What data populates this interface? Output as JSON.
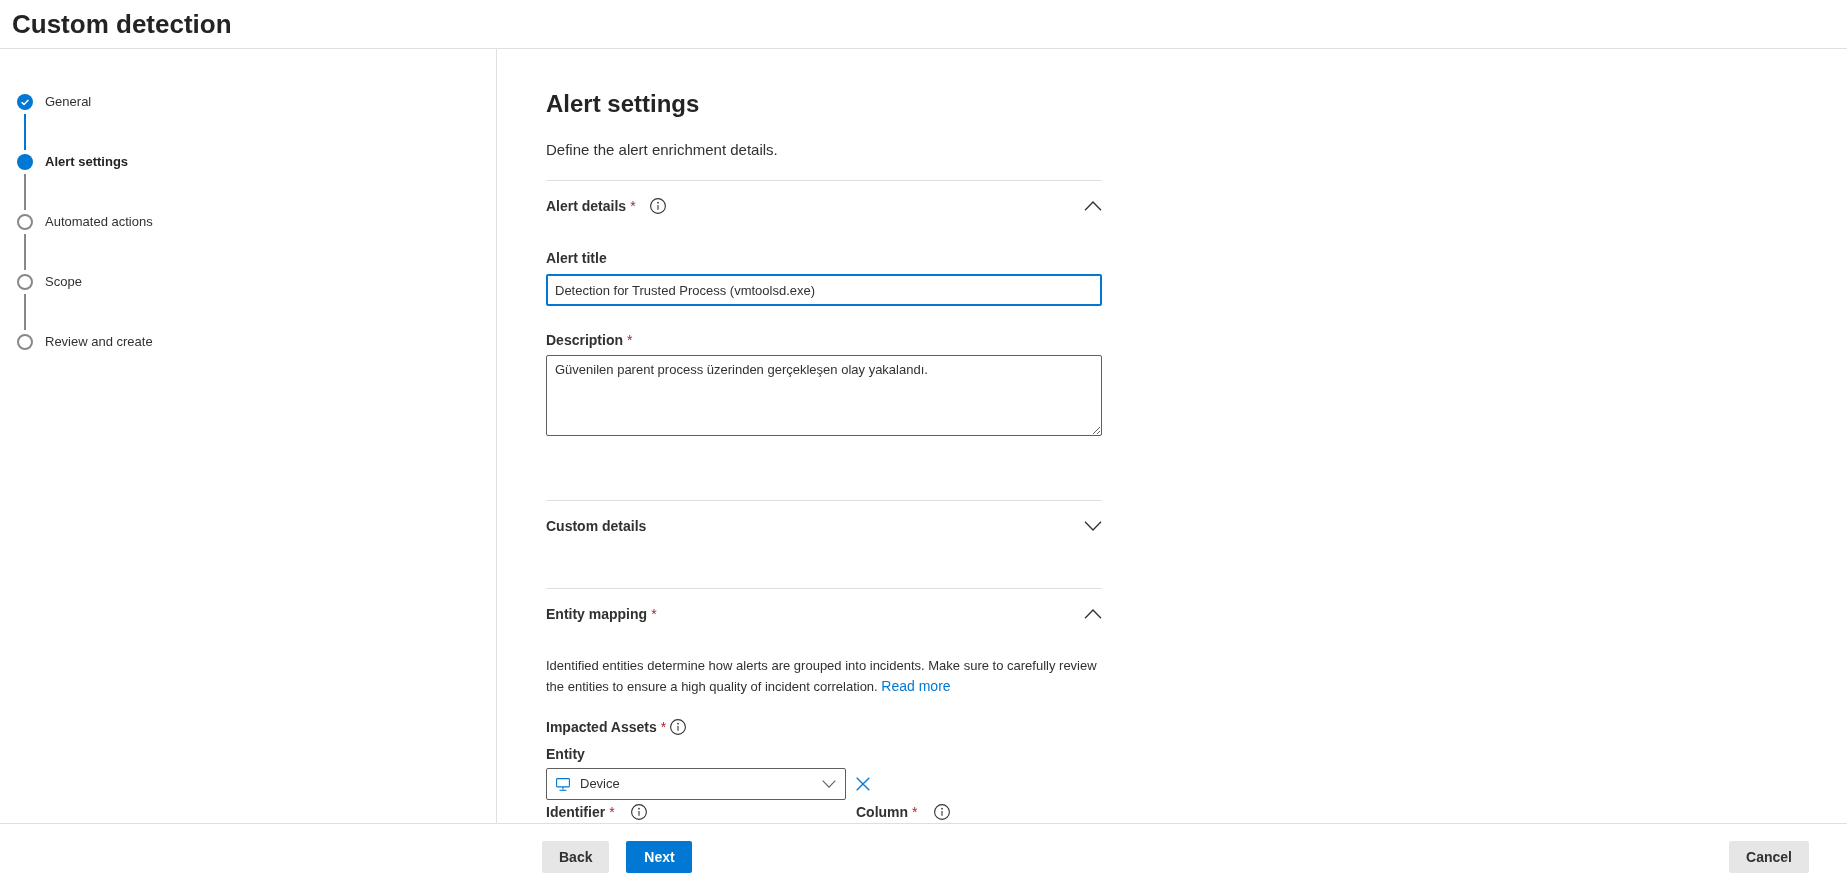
{
  "header": {
    "title": "Custom detection"
  },
  "steps": [
    {
      "label": "General",
      "completed": true,
      "selected": false
    },
    {
      "label": "Alert settings",
      "completed": false,
      "selected": true
    },
    {
      "label": "Automated actions",
      "completed": false,
      "selected": false
    },
    {
      "label": "Scope",
      "completed": false,
      "selected": false
    },
    {
      "label": "Review and create",
      "completed": false,
      "selected": false
    }
  ],
  "page": {
    "title": "Alert settings",
    "subtitle": "Define the alert enrichment details."
  },
  "sections": [
    {
      "title": "Alert details",
      "required_mark": "*",
      "info": true,
      "expanded": true,
      "fields": [
        {
          "kind": "input",
          "label": "Alert title",
          "value": "Detection for Trusted Process (vmtoolsd.exe)",
          "focused": true
        },
        {
          "kind": "textarea",
          "label": "Description",
          "required_mark": "*",
          "value": "Güvenilen parent process üzerinden gerçekleşen olay yakalandı."
        }
      ]
    },
    {
      "title": "Custom details",
      "expanded": false
    },
    {
      "title": "Entity mapping",
      "required_mark": "*",
      "expanded": true,
      "description": "Identified entities determine how alerts are grouped into incidents. Make sure to carefully review the entities to ensure a high quality of incident correlation.",
      "link": "Read more",
      "groups": [
        {
          "label": "Impacted Assets",
          "required_mark": "*",
          "info": true,
          "entities": [
            {
              "label": "Entity",
              "value": "Device",
              "columns": [
                {
                  "label": "Identifier",
                  "required_mark": "*",
                  "info": true
                },
                {
                  "label": "Column",
                  "required_mark": "*",
                  "info": true
                }
              ]
            }
          ]
        }
      ]
    }
  ],
  "footer": {
    "actions": [
      {
        "label": "Back",
        "kind": "secondary"
      },
      {
        "label": "Next",
        "kind": "primary"
      }
    ],
    "cancel": {
      "label": "Cancel",
      "kind": "secondary"
    }
  }
}
